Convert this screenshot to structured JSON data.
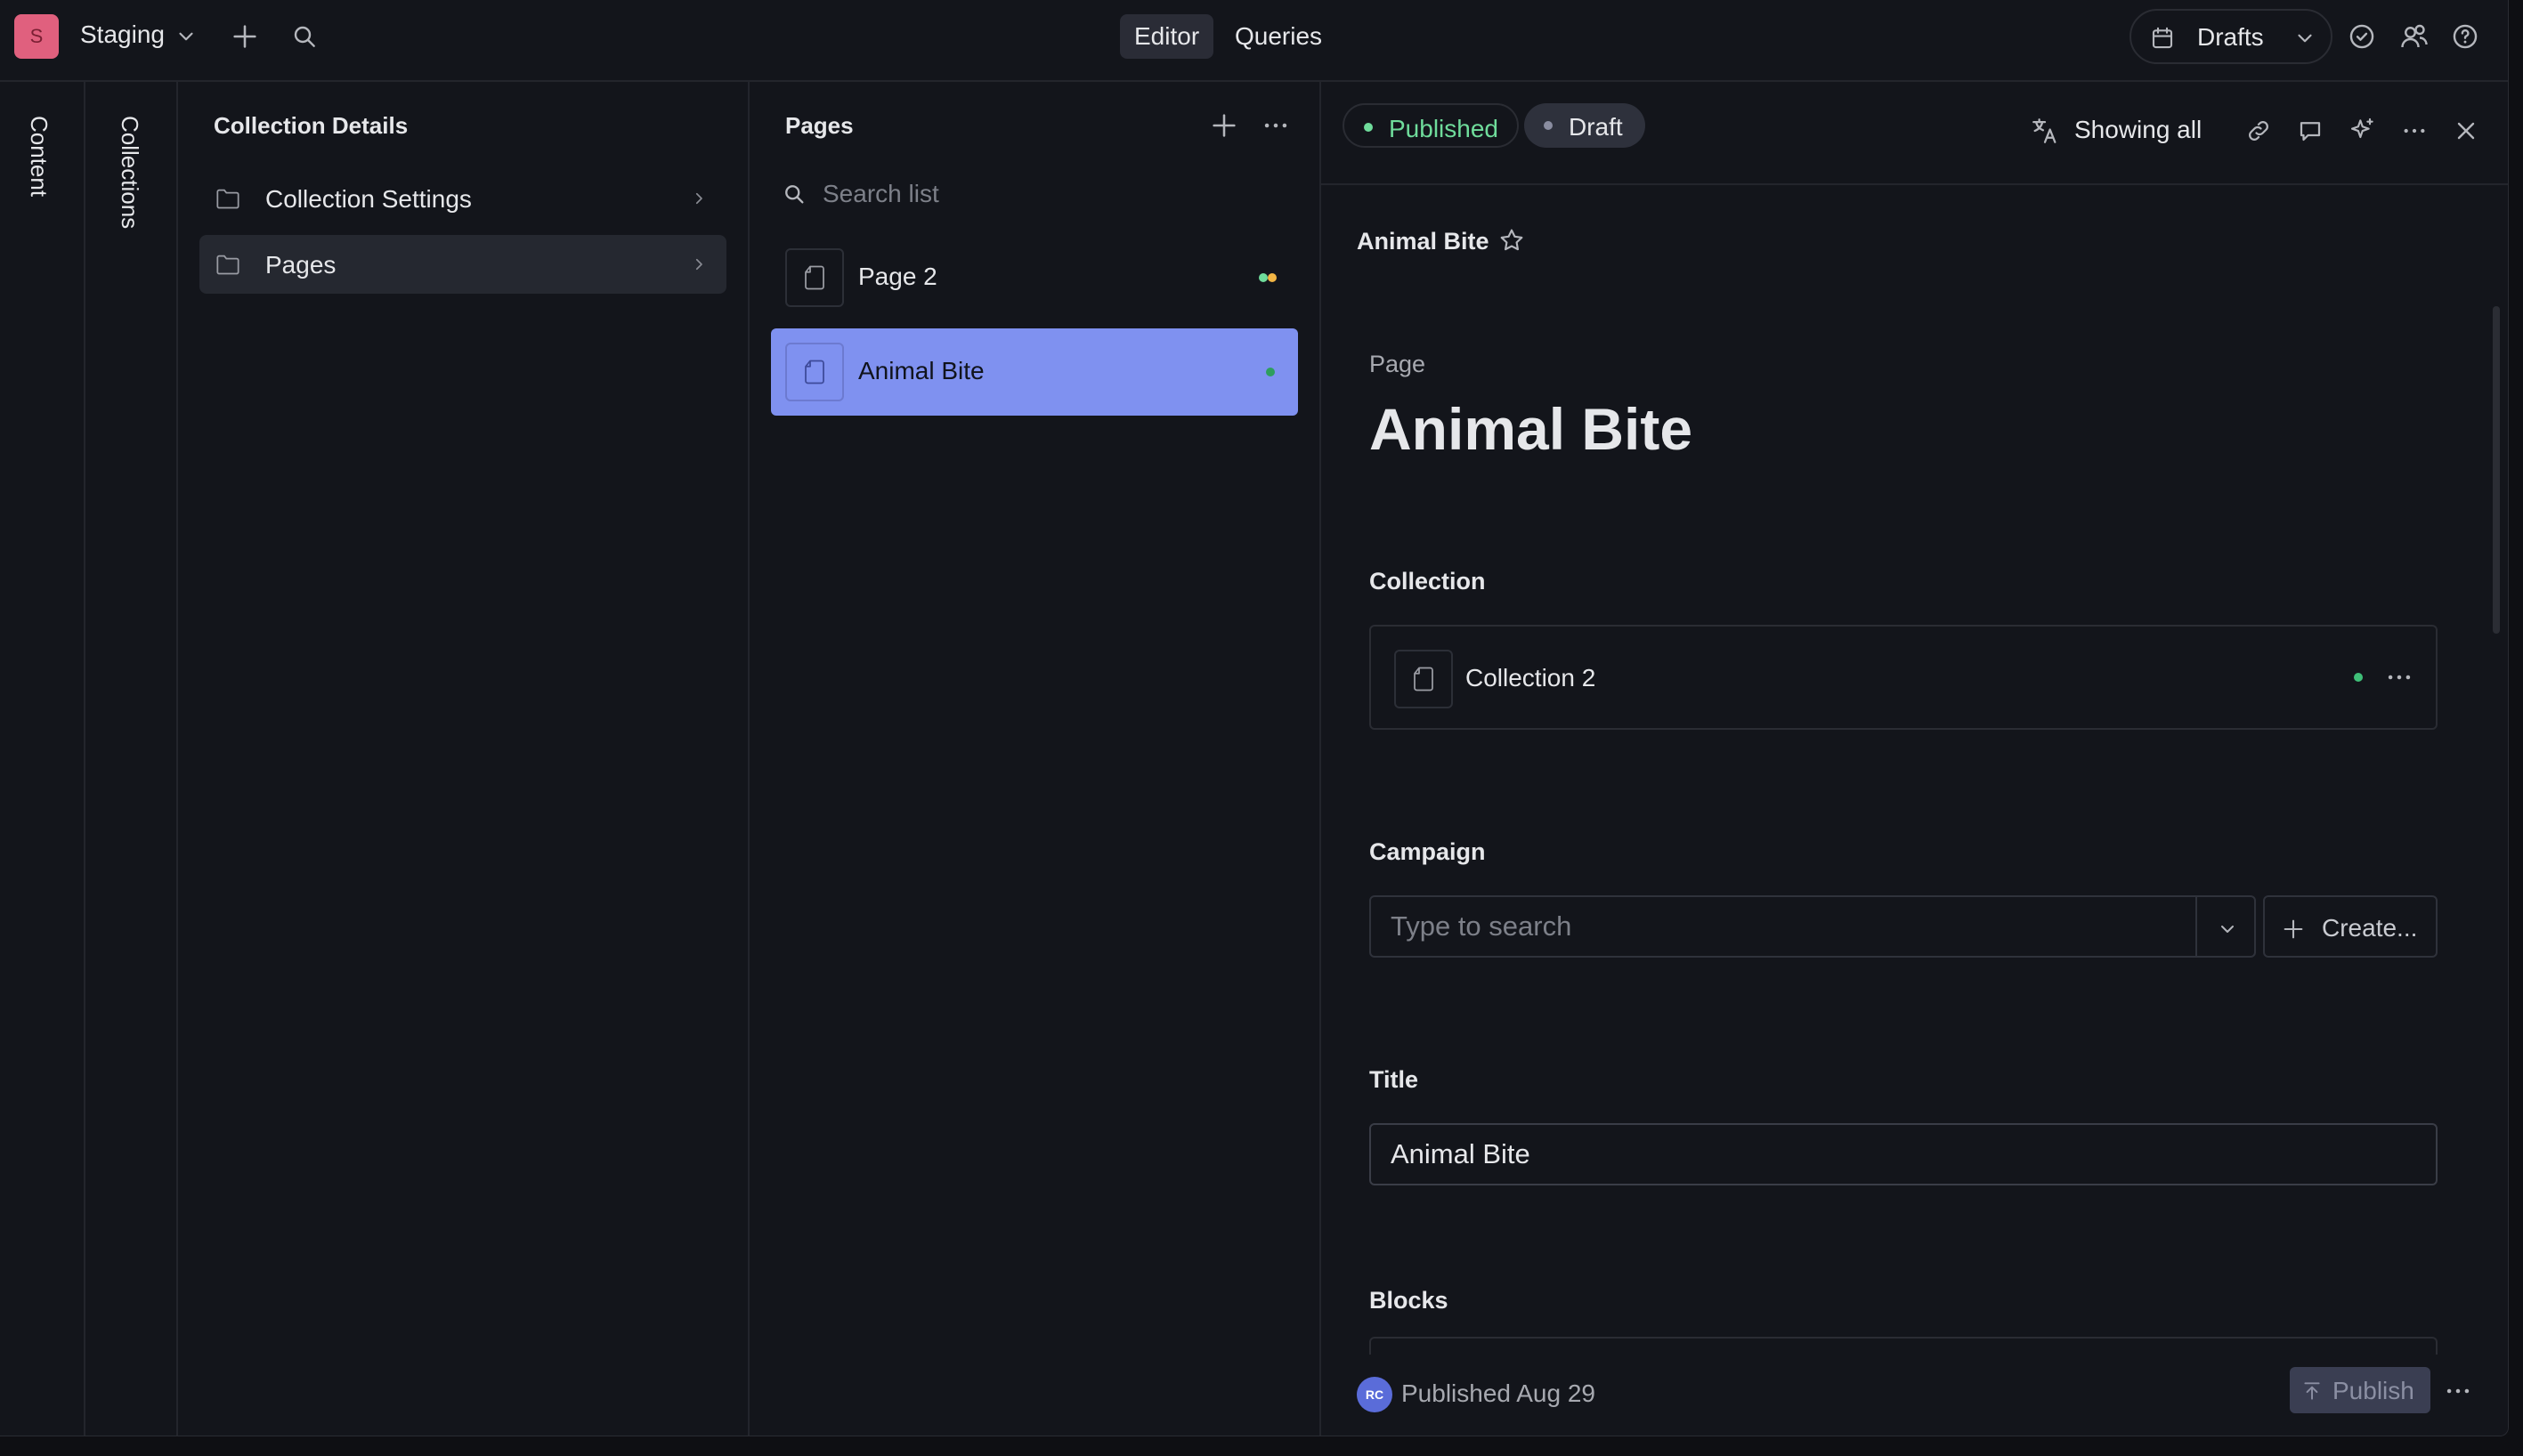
{
  "workspace": {
    "initial": "S",
    "name": "Staging"
  },
  "topbar": {
    "modes": [
      {
        "label": "Editor",
        "active": true
      },
      {
        "label": "Queries",
        "active": false
      }
    ],
    "release_selector": "Drafts"
  },
  "rails": {
    "content_label": "Content",
    "collections_label": "Collections"
  },
  "collection_details": {
    "title": "Collection Details",
    "items": [
      {
        "label": "Collection Settings",
        "icon": "folder-icon",
        "selected": false
      },
      {
        "label": "Pages",
        "icon": "folder-icon",
        "selected": true
      }
    ]
  },
  "pages_list": {
    "title": "Pages",
    "search_placeholder": "Search list",
    "items": [
      {
        "label": "Page 2",
        "status_dots": [
          "#6fdc9b",
          "#f2b544"
        ],
        "selected": false
      },
      {
        "label": "Animal Bite",
        "status_dots": [
          "#3a9e63"
        ],
        "selected": true
      }
    ]
  },
  "editor": {
    "status_pills": {
      "published": "Published",
      "draft": "Draft"
    },
    "language_filter": "Showing all",
    "breadcrumb": "Animal Bite",
    "doc_type": "Page",
    "doc_title": "Animal Bite",
    "fields": {
      "collection": {
        "label": "Collection",
        "value": "Collection 2"
      },
      "campaign": {
        "label": "Campaign",
        "placeholder": "Type to search",
        "create_label": "Create..."
      },
      "title": {
        "label": "Title",
        "value": "Animal Bite"
      },
      "blocks": {
        "label": "Blocks"
      }
    },
    "footer": {
      "avatar_initials": "RC",
      "status": "Published Aug 29",
      "publish_label": "Publish"
    }
  },
  "colors": {
    "accent": "#7f91f0",
    "published": "#6fdc9b",
    "workspace": "#e0607e"
  }
}
